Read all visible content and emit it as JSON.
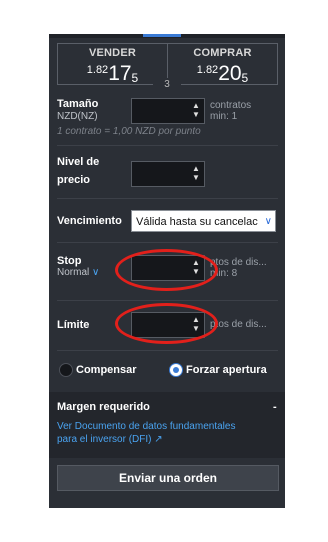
{
  "colors": {
    "panel": "#2b2f36",
    "accent": "#3a7bd5",
    "link": "#4aa3f0",
    "annotation": "#e2201b"
  },
  "sell": {
    "label": "VENDER",
    "price_prefix": "1.82",
    "price_big": "17",
    "price_small": "5"
  },
  "buy": {
    "label": "COMPRAR",
    "price_prefix": "1.82",
    "price_big": "20",
    "price_small": "5"
  },
  "spread": "3",
  "size": {
    "label": "Tamaño",
    "currency": "NZD(NZ)",
    "value": "",
    "unit": "contratos",
    "min": "min: 1",
    "hint": "1 contrato = 1,00 NZD por punto"
  },
  "price_level": {
    "label_line1": "Nivel de",
    "label_line2": "precio",
    "value": ""
  },
  "expiry": {
    "label": "Vencimiento",
    "selected": "Válida hasta su cancelac"
  },
  "stop": {
    "label": "Stop",
    "type": "Normal",
    "value": "",
    "unit": "ptos de dis...",
    "min": "min: 8"
  },
  "limit": {
    "label": "Límite",
    "value": "",
    "unit": "ptos de dis..."
  },
  "options": {
    "compensate": "Compensar",
    "force_open": "Forzar apertura",
    "selected": "force_open"
  },
  "margin": {
    "label": "Margen requerido",
    "value": "-",
    "link_line1": "Ver Documento de datos fundamentales",
    "link_line2": "para el inversor (DFI)"
  },
  "submit_label": "Enviar una orden"
}
